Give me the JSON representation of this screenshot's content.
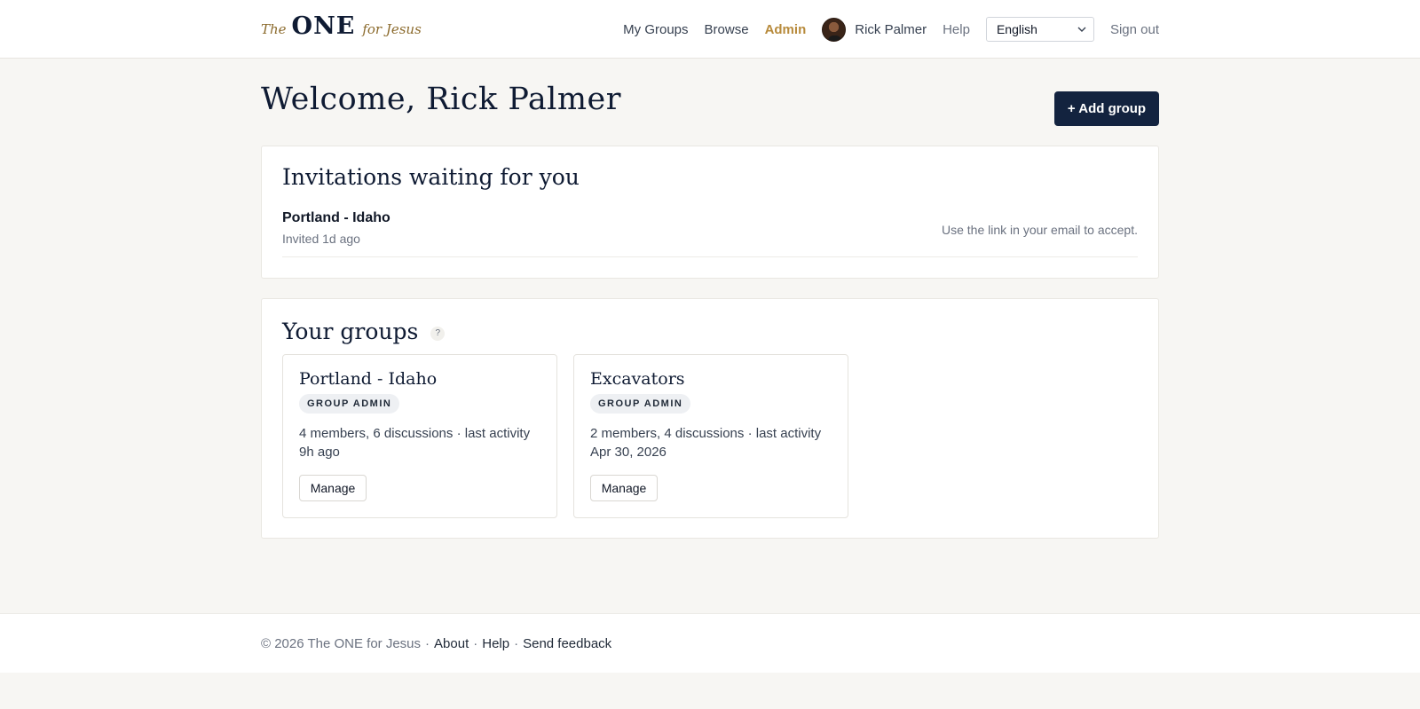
{
  "brand": {
    "the": "The",
    "one": "ONE",
    "for": "for Jesus"
  },
  "nav": {
    "my_groups": "My Groups",
    "browse": "Browse",
    "admin": "Admin",
    "user_name": "Rick Palmer",
    "help": "Help",
    "language": "English",
    "sign_out": "Sign out"
  },
  "page": {
    "welcome": "Welcome, Rick Palmer",
    "add_group": "+ Add group"
  },
  "invitations": {
    "title": "Invitations waiting for you",
    "items": [
      {
        "name": "Portland - Idaho",
        "time": "Invited 1d ago",
        "hint": "Use the link in your email to accept."
      }
    ]
  },
  "groups": {
    "title": "Your groups",
    "help_icon": "?",
    "items": [
      {
        "name": "Portland - Idaho",
        "role": "GROUP ADMIN",
        "meta": "4 members, 6 discussions · last activity 9h ago",
        "action": "Manage"
      },
      {
        "name": "Excavators",
        "role": "GROUP ADMIN",
        "meta": "2 members, 4 discussions · last activity Apr 30, 2026",
        "action": "Manage"
      }
    ]
  },
  "footer": {
    "copyright": "© 2026 The ONE for Jesus",
    "sep": "·",
    "about": "About",
    "help": "Help",
    "feedback": "Send feedback"
  },
  "colors": {
    "accent": "#b78a3b",
    "primary": "#13233f",
    "background": "#f7f6f3"
  }
}
